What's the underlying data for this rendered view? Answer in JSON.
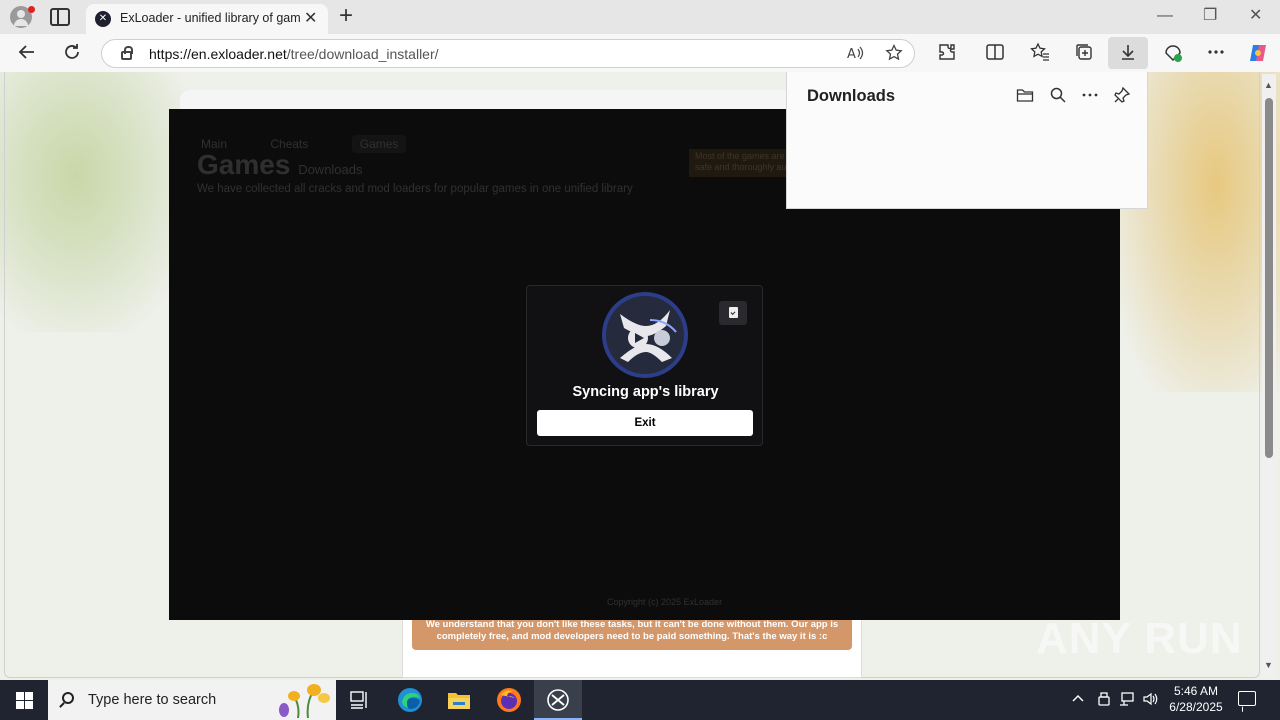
{
  "browser": {
    "tab": {
      "title": "ExLoader - unified library of games",
      "favicon_icon": "exloader-icon",
      "close_glyph": "✕"
    },
    "new_tab_glyph": "+",
    "window": {
      "minimize": "—",
      "restore": "❐",
      "close": "✕"
    },
    "address": {
      "url_host": "https://en.exloader.net",
      "url_path": "/tree/download_installer/"
    },
    "toolbar_icons": [
      "back-icon",
      "refresh-icon",
      "read-aloud-icon",
      "favorite-star-icon",
      "extensions-icon",
      "split-screen-icon",
      "favorites-icon",
      "collections-icon",
      "downloads-icon",
      "browser-essentials-icon",
      "more-icon",
      "copilot-icon"
    ]
  },
  "downloads_panel": {
    "title": "Downloads",
    "icons": [
      "open-folder-icon",
      "search-icon",
      "more-options-icon",
      "pin-icon"
    ]
  },
  "app_overlay": {
    "background_nav": [
      "Main",
      "Cheats",
      "Games"
    ],
    "background_title": "Games",
    "background_title_extra": "Downloads",
    "background_subtitle": "We have collected all cracks and mod loaders for popular games in one unified library",
    "background_warning_line1": "Most of the games are infected with malware, be sure to use antivirus and be careful. Our app is",
    "background_warning_line2": "safe and thoroughly audited. Use at your own risk, we warned you.",
    "background_footer": "Copyright (c) 2025 ExLoader",
    "modal": {
      "status": "Syncing app's library",
      "exit_label": "Exit",
      "logo_icon": "exloader-logo-icon",
      "copy_icon": "clipboard-check-icon"
    }
  },
  "page": {
    "donation_text": "We understand that you don't like these tasks, but it can't be done without them. Our app is completely free, and mod developers need to be paid something. That's the way it is :c",
    "accent_color": "#d4976a"
  },
  "watermark": "ANY RUN",
  "taskbar": {
    "search_placeholder": "Type here to search",
    "apps": [
      "task-view-icon",
      "edge-icon",
      "file-explorer-icon",
      "firefox-icon",
      "exloader-icon"
    ],
    "tray_icons": [
      "chevron-up-icon",
      "usb-icon",
      "network-icon",
      "volume-icon"
    ],
    "time": "5:46 AM",
    "date": "6/28/2025"
  }
}
